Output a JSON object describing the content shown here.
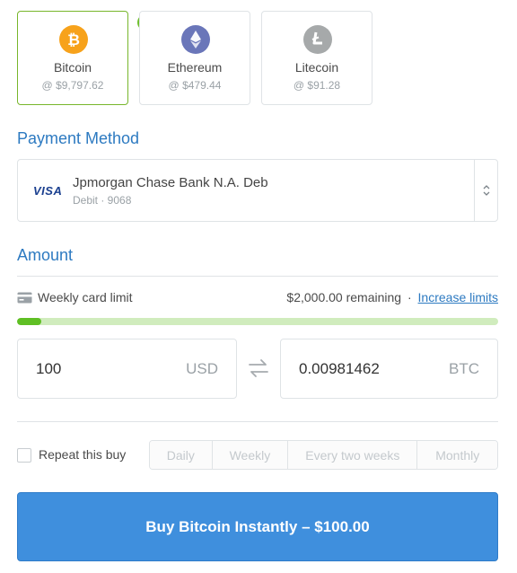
{
  "currencies": [
    {
      "name": "Bitcoin",
      "price": "@ $9,797.62",
      "selected": true,
      "color": "#f7a21b",
      "icon": "bitcoin-icon"
    },
    {
      "name": "Ethereum",
      "price": "@ $479.44",
      "selected": false,
      "color": "#6a76b9",
      "icon": "ethereum-icon"
    },
    {
      "name": "Litecoin",
      "price": "@ $91.28",
      "selected": false,
      "color": "#a6a9aa",
      "icon": "litecoin-icon"
    }
  ],
  "payment": {
    "title": "Payment Method",
    "card_brand": "VISA",
    "bank_name": "Jpmorgan Chase Bank N.A. Deb",
    "account_detail": "Debit · 9068"
  },
  "amount": {
    "title": "Amount",
    "limit_label": "Weekly card limit",
    "remaining": "$2,000.00 remaining",
    "separator": "·",
    "increase_link": "Increase limits",
    "limit_used_fraction": 0.05,
    "fiat_value": "100",
    "fiat_unit": "USD",
    "crypto_value": "0.00981462",
    "crypto_unit": "BTC"
  },
  "repeat": {
    "label": "Repeat this buy",
    "checked": false,
    "options": [
      "Daily",
      "Weekly",
      "Every two weeks",
      "Monthly"
    ]
  },
  "buy_button": {
    "label": "Buy Bitcoin Instantly – $100.00"
  },
  "colors": {
    "accent": "#2d7ac1",
    "button": "#3f8fdd",
    "success": "#6fbf2d"
  }
}
